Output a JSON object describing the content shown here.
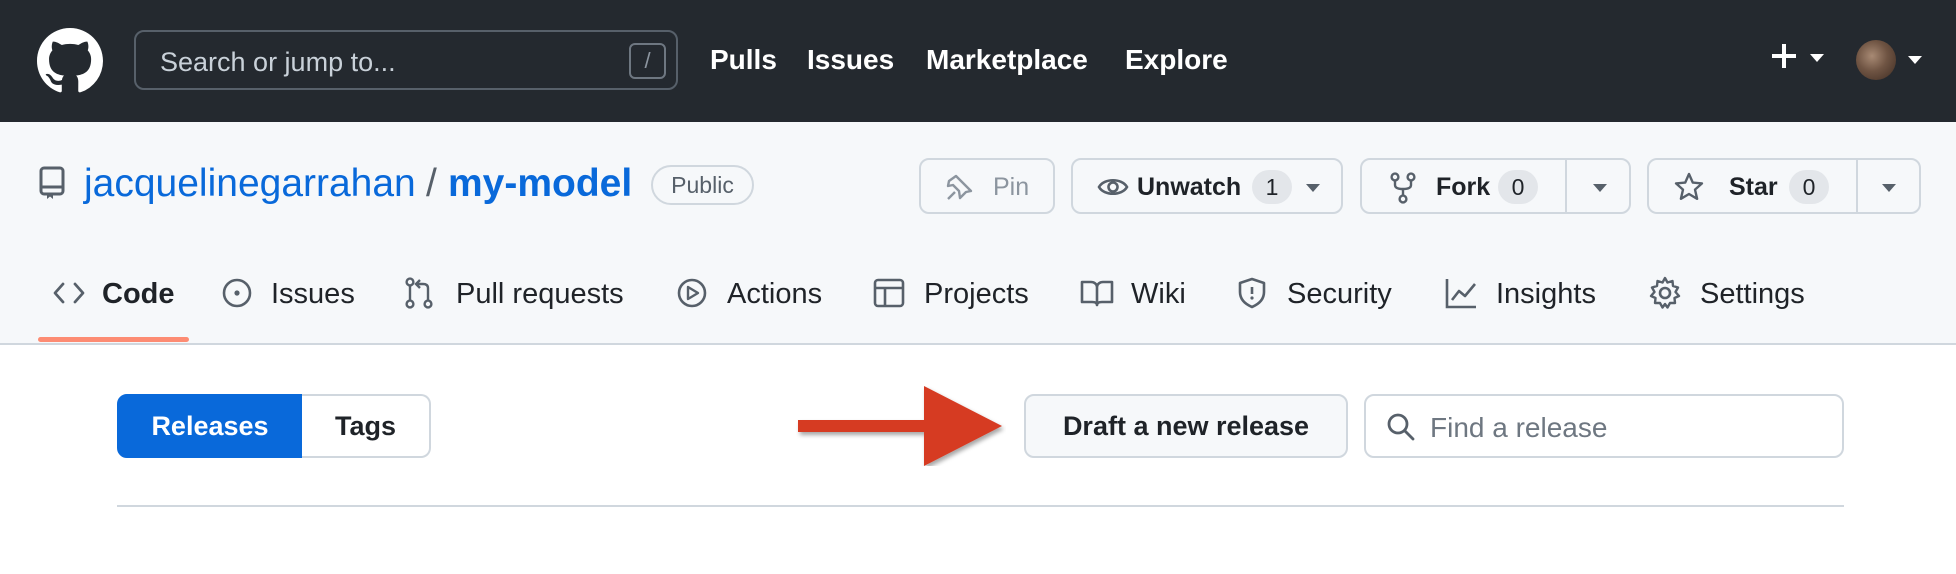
{
  "colors": {
    "header_bg": "#24292f",
    "link": "#0969da",
    "accent_underline": "#fd8c73",
    "primary_button": "#0969da",
    "arrow": "#d63a24"
  },
  "header": {
    "logo_icon": "github-mark-icon",
    "search_placeholder": "Search or jump to...",
    "search_shortcut": "/",
    "nav": [
      "Pulls",
      "Issues",
      "Marketplace",
      "Explore"
    ],
    "plus_icon": "plus-icon",
    "avatar": "user-avatar"
  },
  "repo": {
    "owner": "jacquelinegarrahan",
    "separator": "/",
    "name": "my-model",
    "visibility": "Public",
    "actions": {
      "pin": "Pin",
      "unwatch": "Unwatch",
      "unwatch_count": "1",
      "fork": "Fork",
      "fork_count": "0",
      "star": "Star",
      "star_count": "0"
    },
    "tabs": [
      {
        "label": "Code",
        "icon": "code-icon",
        "selected": true
      },
      {
        "label": "Issues",
        "icon": "issue-opened-icon"
      },
      {
        "label": "Pull requests",
        "icon": "git-pull-request-icon"
      },
      {
        "label": "Actions",
        "icon": "play-icon"
      },
      {
        "label": "Projects",
        "icon": "table-icon"
      },
      {
        "label": "Wiki",
        "icon": "book-icon"
      },
      {
        "label": "Security",
        "icon": "shield-icon"
      },
      {
        "label": "Insights",
        "icon": "graph-icon"
      },
      {
        "label": "Settings",
        "icon": "gear-icon"
      }
    ]
  },
  "releases": {
    "segmented": [
      "Releases",
      "Tags"
    ],
    "selected": "Releases",
    "draft_button": "Draft a new release",
    "find_placeholder": "Find a release"
  }
}
